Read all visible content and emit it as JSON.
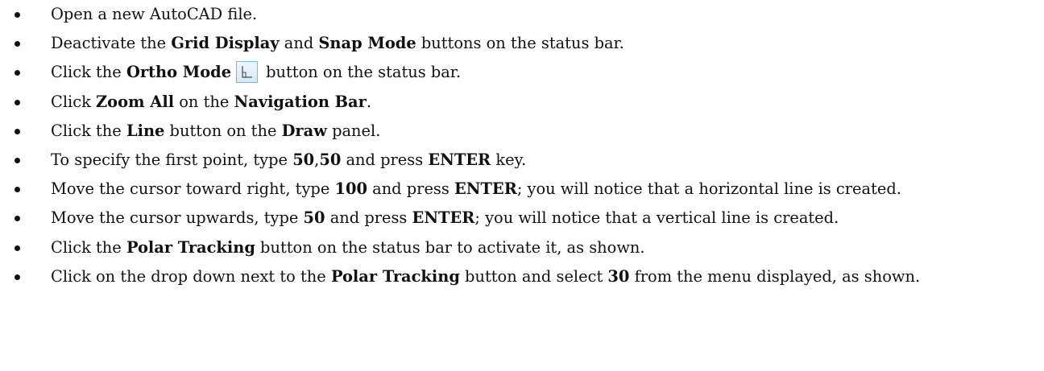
{
  "steps": [
    {
      "parts": [
        {
          "t": "Open a new AutoCAD file.",
          "b": false
        }
      ]
    },
    {
      "parts": [
        {
          "t": "Deactivate the ",
          "b": false
        },
        {
          "t": "Grid Display",
          "b": true
        },
        {
          "t": " and ",
          "b": false
        },
        {
          "t": "Snap Mode",
          "b": true
        },
        {
          "t": " buttons on the status bar.",
          "b": false
        }
      ]
    },
    {
      "parts": [
        {
          "t": "Click the ",
          "b": false
        },
        {
          "t": "Ortho Mode",
          "b": true
        },
        {
          "icon": "ortho-mode-icon"
        },
        {
          "t": "button on the status bar.",
          "b": false
        }
      ]
    },
    {
      "parts": [
        {
          "t": "Click ",
          "b": false
        },
        {
          "t": "Zoom All",
          "b": true
        },
        {
          "t": " on the ",
          "b": false
        },
        {
          "t": "Navigation Bar",
          "b": true
        },
        {
          "t": ".",
          "b": false
        }
      ]
    },
    {
      "parts": [
        {
          "t": "Click the ",
          "b": false
        },
        {
          "t": "Line",
          "b": true
        },
        {
          "t": " button on the ",
          "b": false
        },
        {
          "t": "Draw",
          "b": true
        },
        {
          "t": " panel.",
          "b": false
        }
      ]
    },
    {
      "parts": [
        {
          "t": "To specify the first point, type ",
          "b": false
        },
        {
          "t": "50",
          "b": true
        },
        {
          "t": ",",
          "b": false
        },
        {
          "t": "50",
          "b": true
        },
        {
          "t": " and press ",
          "b": false
        },
        {
          "t": "ENTER",
          "b": true
        },
        {
          "t": " key.",
          "b": false
        }
      ]
    },
    {
      "parts": [
        {
          "t": "Move the cursor toward right, type ",
          "b": false
        },
        {
          "t": "100",
          "b": true
        },
        {
          "t": " and press ",
          "b": false
        },
        {
          "t": "ENTER",
          "b": true
        },
        {
          "t": "; you will notice that a horizontal line is created.",
          "b": false
        }
      ]
    },
    {
      "parts": [
        {
          "t": "Move the cursor upwards, type ",
          "b": false
        },
        {
          "t": "50",
          "b": true
        },
        {
          "t": " and press ",
          "b": false
        },
        {
          "t": "ENTER",
          "b": true
        },
        {
          "t": "; you will notice that a vertical line is created.",
          "b": false
        }
      ]
    },
    {
      "parts": [
        {
          "t": "Click the ",
          "b": false
        },
        {
          "t": "Polar Tracking",
          "b": true
        },
        {
          "t": " button on the status bar to activate it, as shown.",
          "b": false
        }
      ]
    },
    {
      "parts": [
        {
          "t": "Click on the drop down next to the ",
          "b": false
        },
        {
          "t": "Polar Tracking",
          "b": true
        },
        {
          "t": " button and select ",
          "b": false
        },
        {
          "t": "30",
          "b": true
        },
        {
          "t": " from the menu displayed, as shown.",
          "b": false
        }
      ]
    }
  ],
  "colors": {
    "text": "#111111",
    "background": "#ffffff",
    "icon_border": "#7fb3e0",
    "icon_fill": "#d6e9f9"
  }
}
